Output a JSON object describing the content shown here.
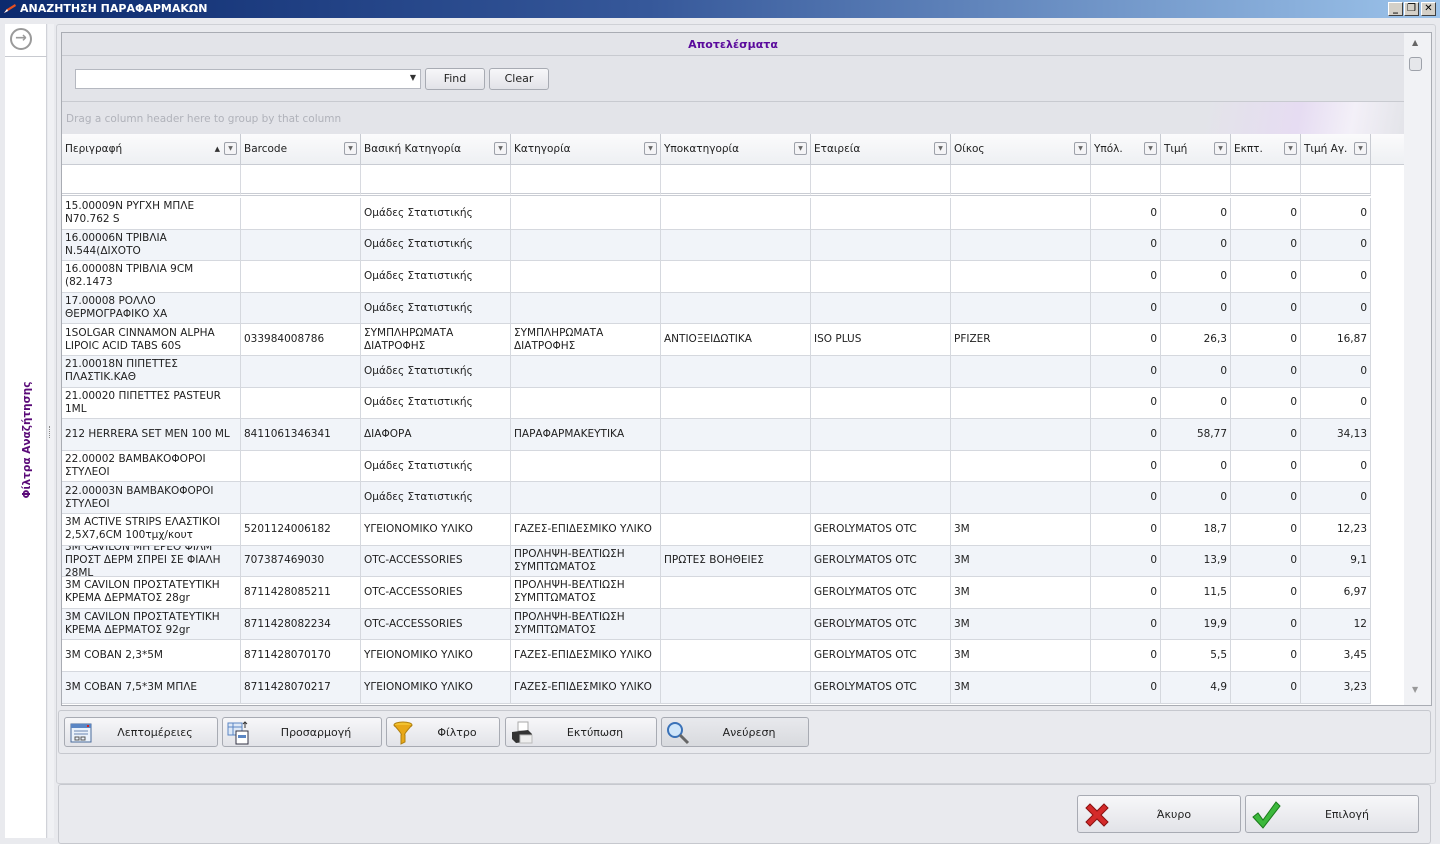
{
  "window": {
    "title": "ΑΝΑΖΗΤΗΣΗ ΠΑΡΑΦΑΡΜΑΚΩΝ",
    "min": "_",
    "restore": "❐",
    "close": "✕"
  },
  "sidebar": {
    "label": "Φίλτρα Αναζήτησης",
    "toggle_icon": "arrow-right-circle-icon"
  },
  "results": {
    "title": "Αποτελέσματα",
    "search": {
      "value": "",
      "find_label": "Find",
      "clear_label": "Clear"
    },
    "group_hint": "Drag a column header here to group by that column",
    "columns": [
      "Περιγραφή",
      "Barcode",
      "Βασική Κατηγορία",
      "Κατηγορία",
      "Υποκατηγορία",
      "Εταιρεία",
      "Οίκος",
      "Υπόλ.",
      "Τιμή",
      "Εκπτ.",
      "Τιμή Αγ."
    ],
    "sorted_column": "Περιγραφή",
    "sort_direction": "ascending",
    "rows": [
      [
        "15.00009Ν ΡΥΓΧΗ ΜΠΛΕ Ν70.762 S",
        "",
        "Ομάδες Στατιστικής",
        "",
        "",
        "",
        "",
        "0",
        "0",
        "0",
        "0"
      ],
      [
        "16.00006Ν ΤΡΙΒΛΙΑ Ν.544(ΔΙΧΟΤΟ",
        "",
        "Ομάδες Στατιστικής",
        "",
        "",
        "",
        "",
        "0",
        "0",
        "0",
        "0"
      ],
      [
        "16.00008Ν ΤΡΙΒΛΙΑ 9CM (82.1473",
        "",
        "Ομάδες Στατιστικής",
        "",
        "",
        "",
        "",
        "0",
        "0",
        "0",
        "0"
      ],
      [
        "17.00008 ΡΟΛΛΟ ΘΕΡΜΟΓΡΑΦΙΚΟ ΧΑ",
        "",
        "Ομάδες Στατιστικής",
        "",
        "",
        "",
        "",
        "0",
        "0",
        "0",
        "0"
      ],
      [
        "1SOLGAR CINNAMON ALPHA LIPOIC ACID TABS 60S",
        "033984008786",
        "ΣΥΜΠΛΗΡΩΜΑΤΑ ΔΙΑΤΡΟΦΗΣ",
        "ΣΥΜΠΛΗΡΩΜΑΤΑ ΔΙΑΤΡΟΦΗΣ",
        "ΑΝΤΙΟΞΕΙΔΩΤΙΚΑ",
        "ISO PLUS",
        "PFIZER",
        "0",
        "26,3",
        "0",
        "16,87"
      ],
      [
        "21.00018Ν ΠΙΠΕΤΤΕΣ ΠΛΑΣΤΙΚ.ΚΑΘ",
        "",
        "Ομάδες Στατιστικής",
        "",
        "",
        "",
        "",
        "0",
        "0",
        "0",
        "0"
      ],
      [
        "21.00020 ΠΙΠΕΤΤΕΣ PASTEUR 1ML",
        "",
        "Ομάδες Στατιστικής",
        "",
        "",
        "",
        "",
        "0",
        "0",
        "0",
        "0"
      ],
      [
        "212 HERRERA SET MEN 100 ML",
        "8411061346341",
        "ΔΙΑΦΟΡΑ",
        "ΠΑΡΑΦΑΡΜΑΚΕΥΤΙΚΑ",
        "",
        "",
        "",
        "0",
        "58,77",
        "0",
        "34,13"
      ],
      [
        "22.00002 ΒΑΜΒΑΚΟΦΟΡΟΙ ΣΤΥΛΕΟΙ",
        "",
        "Ομάδες Στατιστικής",
        "",
        "",
        "",
        "",
        "0",
        "0",
        "0",
        "0"
      ],
      [
        "22.00003Ν ΒΑΜΒΑΚΟΦΟΡΟΙ ΣΤΥΛΕΟΙ",
        "",
        "Ομάδες Στατιστικής",
        "",
        "",
        "",
        "",
        "0",
        "0",
        "0",
        "0"
      ],
      [
        "3M ACTIVE STRIPS ΕΛΑΣΤΙΚΟΙ 2,5X7,6CM 100τμχ/κουτ",
        "5201124006182",
        "ΥΓΕΙΟΝΟΜΙΚΟ ΥΛΙΚΟ",
        "ΓΑΖΕΣ-ΕΠΙΔΕΣΜΙΚΟ ΥΛΙΚΟ",
        "",
        "GEROLYMATOS OTC",
        "3M",
        "0",
        "18,7",
        "0",
        "12,23"
      ],
      [
        "3M CAVILON ΜΗ ΕΡΕΘ ΦΙΛΜ ΠΡΟΣΤ ΔΕΡΜ ΣΠΡΕΙ ΣΕ ΦΙΑΛΗ 28ML",
        "707387469030",
        "OTC-ACCESSORIES",
        "ΠΡΟΛΗΨΗ-ΒΕΛΤΙΩΣΗ ΣΥΜΠΤΩΜΑΤΟΣ",
        "ΠΡΩΤΕΣ ΒΟΗΘΕΙΕΣ",
        "GEROLYMATOS OTC",
        "3M",
        "0",
        "13,9",
        "0",
        "9,1"
      ],
      [
        "3M CAVILON ΠΡΟΣΤΑΤΕΥΤΙΚΗ ΚΡΕΜΑ ΔΕΡΜΑΤΟΣ 28gr",
        "8711428085211",
        "OTC-ACCESSORIES",
        "ΠΡΟΛΗΨΗ-ΒΕΛΤΙΩΣΗ ΣΥΜΠΤΩΜΑΤΟΣ",
        "",
        "GEROLYMATOS OTC",
        "3M",
        "0",
        "11,5",
        "0",
        "6,97"
      ],
      [
        "3M CAVILON ΠΡΟΣΤΑΤΕΥΤΙΚΗ ΚΡΕΜΑ ΔΕΡΜΑΤΟΣ 92gr",
        "8711428082234",
        "OTC-ACCESSORIES",
        "ΠΡΟΛΗΨΗ-ΒΕΛΤΙΩΣΗ ΣΥΜΠΤΩΜΑΤΟΣ",
        "",
        "GEROLYMATOS OTC",
        "3M",
        "0",
        "19,9",
        "0",
        "12"
      ],
      [
        "3M COBAN 2,3*5M",
        "8711428070170",
        "ΥΓΕΙΟΝΟΜΙΚΟ ΥΛΙΚΟ",
        "ΓΑΖΕΣ-ΕΠΙΔΕΣΜΙΚΟ ΥΛΙΚΟ",
        "",
        "GEROLYMATOS OTC",
        "3M",
        "0",
        "5,5",
        "0",
        "3,45"
      ],
      [
        "3M COBAN 7,5*3M ΜΠΛΕ",
        "8711428070217",
        "ΥΓΕΙΟΝΟΜΙΚΟ ΥΛΙΚΟ",
        "ΓΑΖΕΣ-ΕΠΙΔΕΣΜΙΚΟ ΥΛΙΚΟ",
        "",
        "GEROLYMATOS OTC",
        "3M",
        "0",
        "4,9",
        "0",
        "3,23"
      ]
    ]
  },
  "toolbar": [
    {
      "label": "Λεπτομέρειες",
      "icon": "details-form-icon"
    },
    {
      "label": "Προσαρμογή",
      "icon": "customize-columns-icon"
    },
    {
      "label": "Φίλτρο",
      "icon": "funnel-icon"
    },
    {
      "label": "Εκτύπωση",
      "icon": "printer-icon"
    },
    {
      "label": "Ανεύρεση",
      "icon": "magnifier-icon"
    }
  ],
  "footer": {
    "cancel_label": "Άκυρο",
    "select_label": "Επιλογή"
  },
  "colors": {
    "title_purple": "#5a0a9c",
    "titlebar_dark": "#0c2a6e",
    "alt_row": "#f1f4f9"
  }
}
